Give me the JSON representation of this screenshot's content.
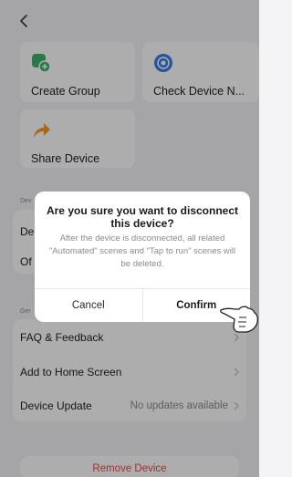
{
  "header": {
    "back_icon": "chevron-left-icon"
  },
  "tiles": [
    {
      "label": "Create Group",
      "icon": "group-icon",
      "color": "#3bb56c"
    },
    {
      "label": "Check Device N...",
      "icon": "network-icon",
      "color": "#3b7de8"
    },
    {
      "label": "Share Device",
      "icon": "share-icon",
      "color": "#f39a2b"
    }
  ],
  "sections": {
    "device_label": "Dev",
    "general_label": "Ger"
  },
  "rows": {
    "partial_1": "De",
    "partial_2": "Of",
    "faq": "FAQ & Feedback",
    "add_home": "Add to Home Screen",
    "device_update": "Device Update",
    "device_update_value": "No updates available"
  },
  "remove_device": "Remove Device",
  "dialog": {
    "title": "Are you sure you want to disconnect this device?",
    "message": "After the device is disconnected, all related \"Automated\" scenes and \"Tap to run\" scenes will be deleted.",
    "cancel": "Cancel",
    "confirm": "Confirm"
  },
  "colors": {
    "danger": "#e54b4b",
    "overlay": "rgba(0,0,0,0.32)"
  }
}
